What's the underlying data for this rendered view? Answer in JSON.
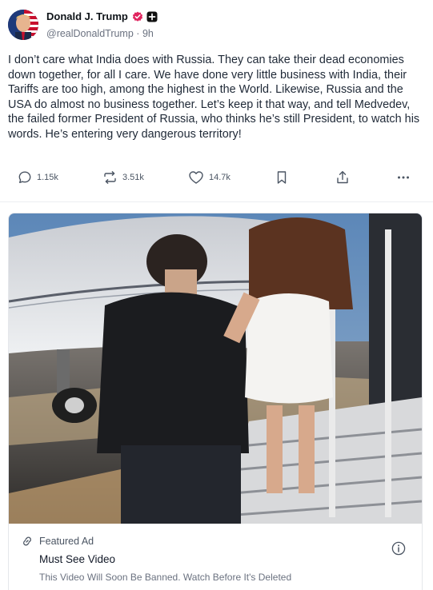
{
  "post": {
    "author": {
      "display_name": "Donald J. Trump",
      "handle": "@realDonaldTrump",
      "separator": "·",
      "time": "9h"
    },
    "text": "I don’t care what India does with Russia. They can take their dead economies down together, for all I care. We have done very little business with India, their Tariffs are too high, among the highest in the World. Likewise, Russia and the USA do almost no business together. Let’s keep it that way, and tell Medvedev, the failed former President of Russia, who thinks he’s still President, to watch his words. He’s entering very dangerous territory!",
    "actions": {
      "replies": "1.15k",
      "reposts": "3.51k",
      "likes": "14.7k"
    }
  },
  "ad": {
    "label": "Featured Ad",
    "title": "Must See Video",
    "subtitle": "This Video Will Soon Be Banned. Watch Before It's Deleted"
  },
  "colors": {
    "verified": "#e0245e",
    "text_muted": "#6b7280",
    "border": "#e5e7eb"
  }
}
